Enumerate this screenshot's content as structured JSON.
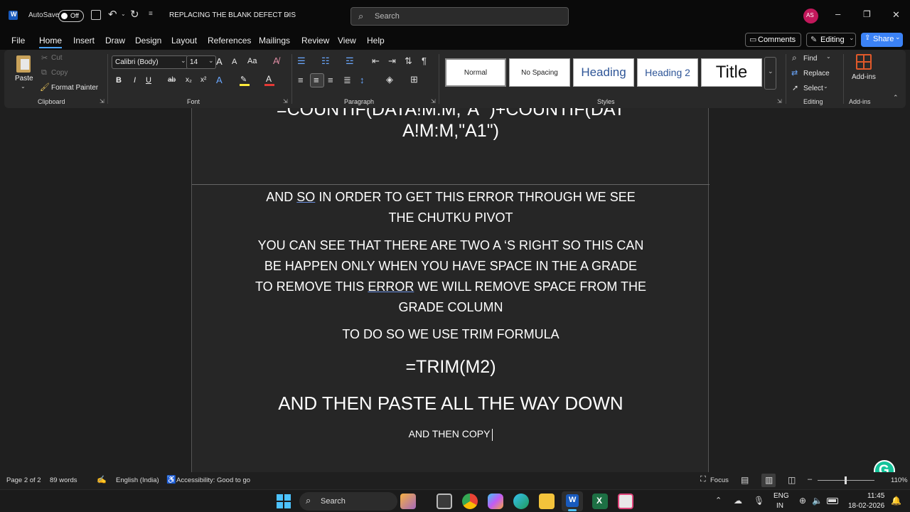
{
  "titlebar": {
    "autosave_label": "AutoSave",
    "autosave_state": "Off",
    "doc_title": "REPLACING THE BLANK DEFECT DIS",
    "search_placeholder": "Search",
    "avatar_initials": "AS",
    "minimize_glyph": "–",
    "restore_glyph": "❐",
    "close_glyph": "✕"
  },
  "menu": {
    "items": [
      "File",
      "Home",
      "Insert",
      "Draw",
      "Design",
      "Layout",
      "References",
      "Mailings",
      "Review",
      "View",
      "Help"
    ],
    "comments_label": "Comments",
    "editing_label": "Editing",
    "share_label": "Share"
  },
  "ribbon": {
    "clipboard": {
      "paste": "Paste",
      "cut": "Cut",
      "copy": "Copy",
      "format_painter": "Format Painter",
      "label": "Clipboard"
    },
    "font": {
      "name": "Calibri (Body)",
      "size": "14",
      "label": "Font",
      "bold": "B",
      "italic": "I",
      "underline": "U",
      "strike": "ab",
      "sub": "x₂",
      "sup": "x²",
      "grow": "A",
      "shrink": "A",
      "case": "Aa"
    },
    "paragraph": {
      "label": "Paragraph"
    },
    "styles": {
      "items": [
        "Normal",
        "No Spacing",
        "Heading",
        "Heading 2",
        "Title"
      ],
      "label": "Styles"
    },
    "editing": {
      "find": "Find",
      "replace": "Replace",
      "select": "Select",
      "label": "Editing"
    },
    "addins": {
      "label": "Add-ins",
      "group_label": "Add-ins"
    }
  },
  "document": {
    "formula_top_line1": "=COUNTIF(DATA!M:M,\"A \")+COUNTIF(DAT",
    "formula_top_line2": "A!M:M,\"A1\")",
    "p1_line1_a": "AND ",
    "p1_line1_so": "SO",
    "p1_line1_b": " IN ORDER TO GET THIS ERROR THROUGH WE SEE",
    "p1_line2": "THE CHUTKU PIVOT",
    "p2_line1": "YOU CAN SEE THAT THERE ARE TWO A ‘S RIGHT SO THIS CAN",
    "p2_line2": "BE HAPPEN ONLY WHEN YOU HAVE SPACE IN THE A GRADE",
    "p2_line3_a": "TO REMOVE THIS ",
    "p2_line3_err": "ERROR",
    "p2_line3_b": " WE WILL REMOVE SPACE FROM THE",
    "p2_line4": "GRADE COLUMN",
    "p3": "TO DO SO WE USE TRIM FORMULA",
    "formula_trim": "=TRIM(M2)",
    "p4": "AND THEN PASTE ALL THE WAY DOWN",
    "p5": "AND THEN COPY"
  },
  "status": {
    "page": "Page 2 of 2",
    "words": "89 words",
    "language": "English (India)",
    "accessibility": "Accessibility: Good to go",
    "focus": "Focus",
    "zoom": "110%"
  },
  "taskbar": {
    "search": "Search",
    "lang_line1": "ENG",
    "lang_line2": "IN",
    "time": "11:45",
    "date": "18-02-2026"
  },
  "colors": {
    "accent": "#4aa3ff",
    "word_blue": "#185abd",
    "share_bg": "#3b82f6",
    "grammarly": "#15c39a",
    "addins_orange": "#e0592a"
  }
}
